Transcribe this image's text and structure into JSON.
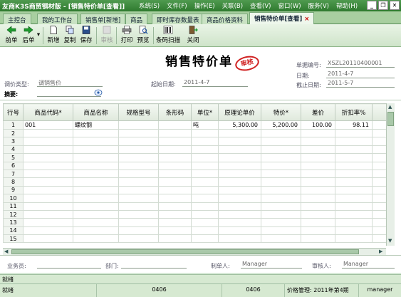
{
  "window": {
    "title": "友商K3S商贸钢材版 - [销售特价单[查看]]",
    "menu": [
      "系统(S)",
      "文件(F)",
      "操作(E)",
      "关联(B)",
      "查看(V)",
      "窗口(W)",
      "服务(V)",
      "帮助(H)"
    ]
  },
  "tabs": [
    {
      "label": "主控台"
    },
    {
      "label": "我的工作台"
    },
    {
      "label": "销售单[新增]"
    },
    {
      "label": "商品"
    },
    {
      "label": "即时库存数量表"
    },
    {
      "label": "商品价格资料"
    },
    {
      "label": "销售特价单[查看]",
      "active": true
    }
  ],
  "toolbar": {
    "prev": "前单",
    "next": "后单",
    "add": "新增",
    "copy": "复制",
    "save": "保存",
    "audit": "审核",
    "print": "打印",
    "preview": "预览",
    "scan": "条码扫描",
    "close": "关闭"
  },
  "form": {
    "title": "销售特价单",
    "stamp": "审核",
    "doc_no_label": "单据编号:",
    "doc_no": "XSZL20110400001",
    "date_label": "日期:",
    "date": "2011-4-7",
    "end_date_label": "截止日期:",
    "end_date": "2011-5-7",
    "price_type_label": "调价类型:",
    "price_type": "调销售价",
    "start_date_label": "起始日期:",
    "start_date": "2011-4-7",
    "summary_label": "摘要:"
  },
  "grid": {
    "columns": [
      "行号",
      "商品代码*",
      "商品名称",
      "规格型号",
      "条形码",
      "单位*",
      "原理论单价",
      "特价*",
      "差价",
      "折扣率%"
    ],
    "rows": [
      [
        "1",
        "001",
        "螺纹钢",
        "",
        "",
        "吨",
        "5,300.00",
        "5,200.00",
        "100.00",
        "98.11"
      ],
      [
        "2",
        "",
        "",
        "",
        "",
        "",
        "",
        "",
        "",
        ""
      ],
      [
        "3",
        "",
        "",
        "",
        "",
        "",
        "",
        "",
        "",
        ""
      ],
      [
        "4",
        "",
        "",
        "",
        "",
        "",
        "",
        "",
        "",
        ""
      ],
      [
        "5",
        "",
        "",
        "",
        "",
        "",
        "",
        "",
        "",
        ""
      ],
      [
        "6",
        "",
        "",
        "",
        "",
        "",
        "",
        "",
        "",
        ""
      ],
      [
        "7",
        "",
        "",
        "",
        "",
        "",
        "",
        "",
        "",
        ""
      ],
      [
        "8",
        "",
        "",
        "",
        "",
        "",
        "",
        "",
        "",
        ""
      ],
      [
        "9",
        "",
        "",
        "",
        "",
        "",
        "",
        "",
        "",
        ""
      ],
      [
        "10",
        "",
        "",
        "",
        "",
        "",
        "",
        "",
        "",
        ""
      ],
      [
        "11",
        "",
        "",
        "",
        "",
        "",
        "",
        "",
        "",
        ""
      ],
      [
        "12",
        "",
        "",
        "",
        "",
        "",
        "",
        "",
        "",
        ""
      ],
      [
        "13",
        "",
        "",
        "",
        "",
        "",
        "",
        "",
        "",
        ""
      ],
      [
        "14",
        "",
        "",
        "",
        "",
        "",
        "",
        "",
        "",
        ""
      ],
      [
        "15",
        "",
        "",
        "",
        "",
        "",
        "",
        "",
        "",
        ""
      ]
    ]
  },
  "footer": {
    "salesperson_label": "业务员:",
    "dept_label": "部门:",
    "maker_label": "制单人:",
    "maker": "Manager",
    "auditor_label": "审核人:",
    "auditor": "Manager"
  },
  "status": {
    "line1": "就绪",
    "ready": "就绪",
    "code1": "0406",
    "code2": "0406",
    "period": "价格管理: 2011年第4期",
    "user": "manager"
  },
  "colors": {
    "stamp": "#d02020",
    "titlebar": "#2f7a2f"
  }
}
